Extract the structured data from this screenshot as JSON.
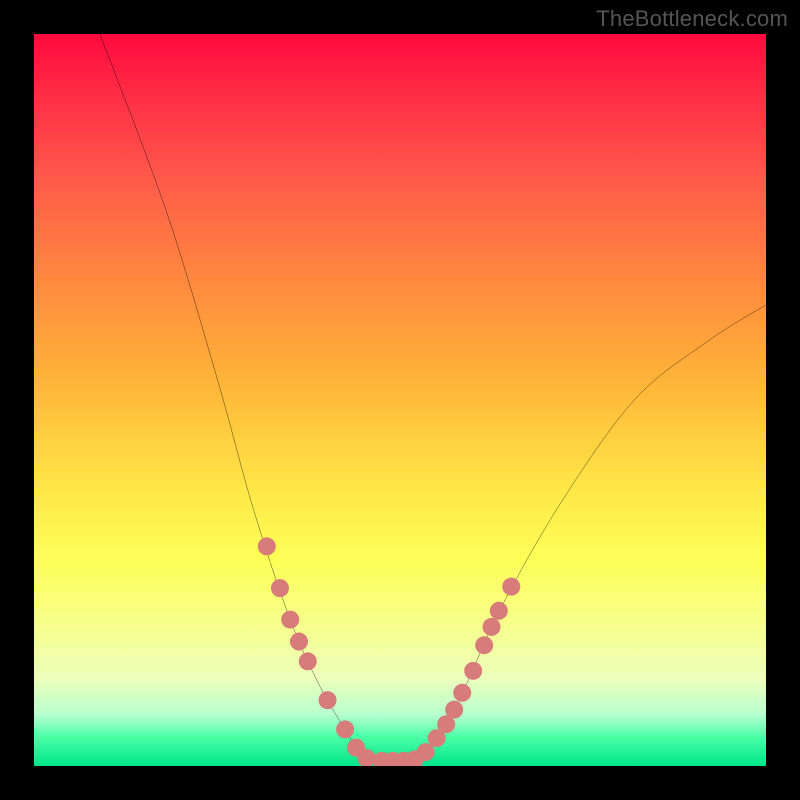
{
  "watermark": "TheBottleneck.com",
  "chart_data": {
    "type": "line",
    "title": "",
    "xlabel": "",
    "ylabel": "",
    "xlim": [
      0,
      100
    ],
    "ylim": [
      0,
      100
    ],
    "curve": {
      "points": [
        {
          "x": 9,
          "y": 100
        },
        {
          "x": 18,
          "y": 76
        },
        {
          "x": 25,
          "y": 53
        },
        {
          "x": 30,
          "y": 35
        },
        {
          "x": 35,
          "y": 20
        },
        {
          "x": 39,
          "y": 11
        },
        {
          "x": 42.5,
          "y": 5
        },
        {
          "x": 45,
          "y": 1.3
        },
        {
          "x": 48,
          "y": 0.7
        },
        {
          "x": 51,
          "y": 0.7
        },
        {
          "x": 53,
          "y": 1.3
        },
        {
          "x": 56,
          "y": 5
        },
        {
          "x": 59,
          "y": 11
        },
        {
          "x": 64,
          "y": 22
        },
        {
          "x": 72,
          "y": 36
        },
        {
          "x": 82,
          "y": 50
        },
        {
          "x": 92,
          "y": 58
        },
        {
          "x": 100,
          "y": 63
        }
      ]
    },
    "markers": [
      {
        "x": 31.8,
        "y": 30.0
      },
      {
        "x": 33.6,
        "y": 24.3
      },
      {
        "x": 35.0,
        "y": 20.0
      },
      {
        "x": 36.2,
        "y": 17.0
      },
      {
        "x": 37.4,
        "y": 14.3
      },
      {
        "x": 40.1,
        "y": 9.0
      },
      {
        "x": 42.5,
        "y": 5.0
      },
      {
        "x": 44.0,
        "y": 2.5
      },
      {
        "x": 45.4,
        "y": 1.1
      },
      {
        "x": 47.5,
        "y": 0.7
      },
      {
        "x": 49.0,
        "y": 0.7
      },
      {
        "x": 50.5,
        "y": 0.7
      },
      {
        "x": 52.0,
        "y": 0.9
      },
      {
        "x": 53.5,
        "y": 1.9
      },
      {
        "x": 55.0,
        "y": 3.8
      },
      {
        "x": 56.3,
        "y": 5.7
      },
      {
        "x": 57.4,
        "y": 7.7
      },
      {
        "x": 58.5,
        "y": 10.0
      },
      {
        "x": 60.0,
        "y": 13.0
      },
      {
        "x": 61.5,
        "y": 16.5
      },
      {
        "x": 62.5,
        "y": 19.0
      },
      {
        "x": 63.5,
        "y": 21.2
      },
      {
        "x": 65.2,
        "y": 24.5
      }
    ],
    "marker_color": "#d87b7b",
    "marker_radius": 9
  }
}
